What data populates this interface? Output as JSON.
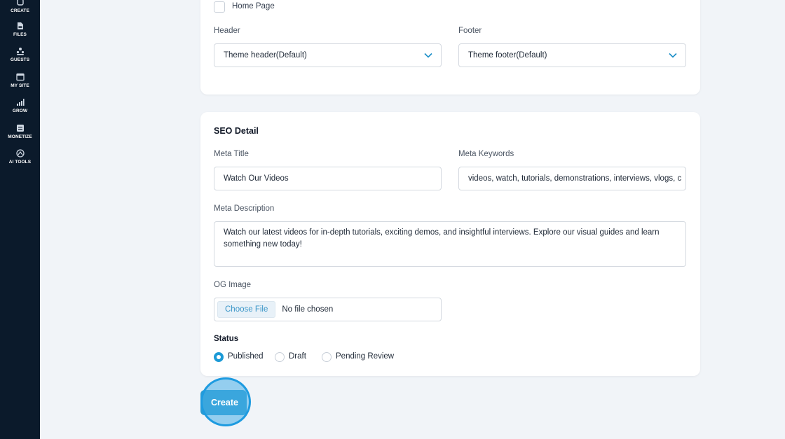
{
  "sidebar": {
    "items": [
      {
        "label": "CREATE",
        "icon": "create-icon"
      },
      {
        "label": "FILES",
        "icon": "files-icon"
      },
      {
        "label": "GUESTS",
        "icon": "guests-icon"
      },
      {
        "label": "MY SITE",
        "icon": "my-site-icon"
      },
      {
        "label": "GROW",
        "icon": "grow-icon"
      },
      {
        "label": "MONETIZE",
        "icon": "monetize-icon"
      },
      {
        "label": "AI TOOLS",
        "icon": "ai-tools-icon"
      }
    ]
  },
  "page_settings": {
    "home_page_label": "Home Page",
    "home_page_checked": false,
    "header_label": "Header",
    "header_value": "Theme header(Default)",
    "footer_label": "Footer",
    "footer_value": "Theme footer(Default)"
  },
  "seo": {
    "title": "SEO Detail",
    "meta_title_label": "Meta Title",
    "meta_title_value": "Watch Our Videos",
    "meta_keywords_label": "Meta Keywords",
    "meta_keywords_value": "videos, watch, tutorials, demonstrations, interviews, vlogs, c",
    "meta_description_label": "Meta Description",
    "meta_description_value": "Watch our latest videos for in-depth tutorials, exciting demos, and insightful interviews. Explore our visual guides and learn something new today!",
    "og_image_label": "OG Image",
    "choose_file_label": "Choose File",
    "no_file_text": "No file chosen",
    "status_label": "Status",
    "status_options": [
      "Published",
      "Draft",
      "Pending Review"
    ],
    "status_selected": "Published"
  },
  "actions": {
    "create_label": "Create"
  },
  "colors": {
    "sidebar_bg": "#0b1a2b",
    "accent": "#1c9ad6",
    "page_bg": "#f1f4f8"
  }
}
